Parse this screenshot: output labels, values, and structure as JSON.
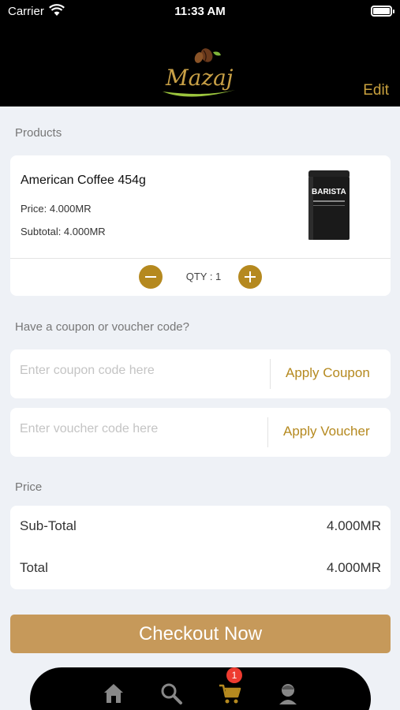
{
  "status_bar": {
    "carrier": "Carrier",
    "time": "11:33 AM"
  },
  "header": {
    "logo_text": "Mazaj",
    "edit_label": "Edit"
  },
  "products": {
    "section_label": "Products",
    "items": [
      {
        "name": "American Coffee 454g",
        "price": "Price: 4.000MR",
        "subtotal": "Subtotal: 4.000MR",
        "qty": "QTY : 1",
        "image_brand": "BARISTA"
      }
    ]
  },
  "coupon": {
    "section_label": "Have a coupon or voucher code?",
    "coupon_placeholder": "Enter coupon code here",
    "coupon_value": "",
    "apply_coupon_label": "Apply Coupon",
    "voucher_placeholder": "Enter voucher code here",
    "voucher_value": "",
    "apply_voucher_label": "Apply Voucher"
  },
  "price": {
    "section_label": "Price",
    "rows": [
      {
        "label": "Sub-Total",
        "value": "4.000MR"
      },
      {
        "label": "Total",
        "value": "4.000MR"
      }
    ]
  },
  "checkout": {
    "label": "Checkout Now"
  },
  "tabbar": {
    "items": [
      {
        "icon": "home-icon"
      },
      {
        "icon": "search-icon"
      },
      {
        "icon": "cart-icon",
        "badge": "1"
      },
      {
        "icon": "profile-icon"
      }
    ],
    "icon_color": "#888888",
    "active_color": "#b5891f"
  },
  "colors": {
    "accent": "#b5891f",
    "checkout": "#c6995a",
    "badge": "#ee3b30"
  }
}
